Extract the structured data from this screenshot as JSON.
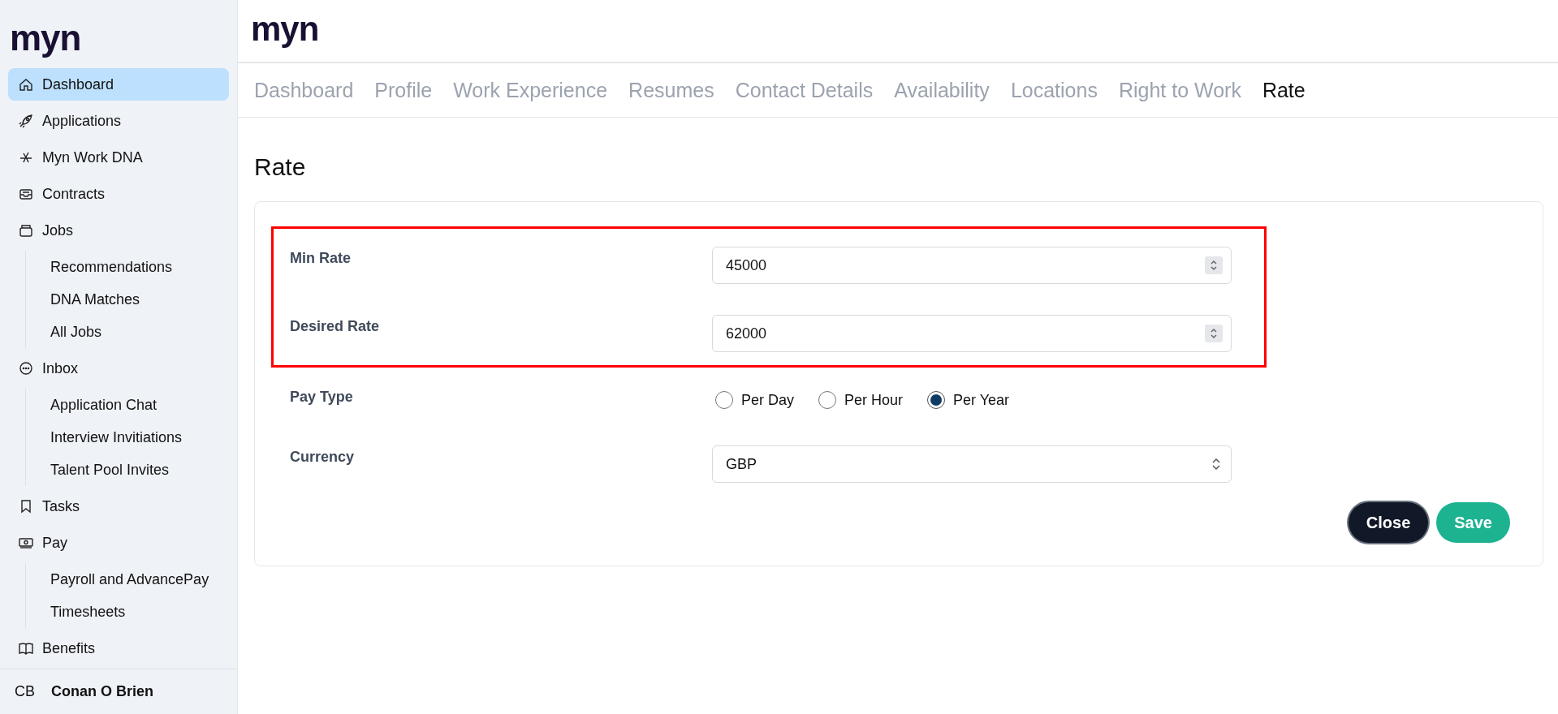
{
  "sidebar": {
    "logo": "myn",
    "items": [
      {
        "label": "Dashboard",
        "selected": true
      },
      {
        "label": "Applications",
        "selected": false
      },
      {
        "label": "Myn Work DNA",
        "selected": false
      },
      {
        "label": "Contracts",
        "selected": false
      },
      {
        "label": "Jobs",
        "selected": false,
        "children": [
          {
            "label": "Recommendations",
            "selected": false
          },
          {
            "label": "DNA Matches",
            "selected": false
          },
          {
            "label": "All Jobs",
            "selected": false
          }
        ]
      },
      {
        "label": "Inbox",
        "selected": false,
        "children": [
          {
            "label": "Application Chat",
            "selected": false
          },
          {
            "label": "Interview Invitiations",
            "selected": false
          },
          {
            "label": "Talent Pool Invites",
            "selected": false
          }
        ]
      },
      {
        "label": "Tasks",
        "selected": false
      },
      {
        "label": "Pay",
        "selected": false,
        "children": [
          {
            "label": "Payroll and AdvancePay",
            "selected": false
          },
          {
            "label": "Timesheets",
            "selected": false
          }
        ]
      },
      {
        "label": "Benefits",
        "selected": false
      }
    ],
    "user": {
      "initials": "CB",
      "name": "Conan O Brien"
    }
  },
  "header": {
    "logo": "myn"
  },
  "tabs": [
    {
      "label": "Dashboard",
      "selected": false
    },
    {
      "label": "Profile",
      "selected": false
    },
    {
      "label": "Work Experience",
      "selected": false
    },
    {
      "label": "Resumes",
      "selected": false
    },
    {
      "label": "Contact Details",
      "selected": false
    },
    {
      "label": "Availability",
      "selected": false
    },
    {
      "label": "Locations",
      "selected": false
    },
    {
      "label": "Right to Work",
      "selected": false
    },
    {
      "label": "Rate",
      "selected": true
    }
  ],
  "page_title": "Rate",
  "form": {
    "fields": [
      {
        "kind": "number",
        "label": "Min Rate",
        "value": "45000",
        "highlighted": true
      },
      {
        "kind": "number",
        "label": "Desired Rate",
        "value": "62000",
        "highlighted": true
      },
      {
        "kind": "radio",
        "label": "Pay Type",
        "options": [
          {
            "label": "Per Day",
            "selected": false
          },
          {
            "label": "Per Hour",
            "selected": false
          },
          {
            "label": "Per Year",
            "selected": true
          }
        ]
      },
      {
        "kind": "select",
        "label": "Currency",
        "value": "GBP"
      }
    ],
    "buttons": [
      {
        "label": "Close",
        "kind": "secondary"
      },
      {
        "label": "Save",
        "kind": "primary"
      }
    ]
  }
}
